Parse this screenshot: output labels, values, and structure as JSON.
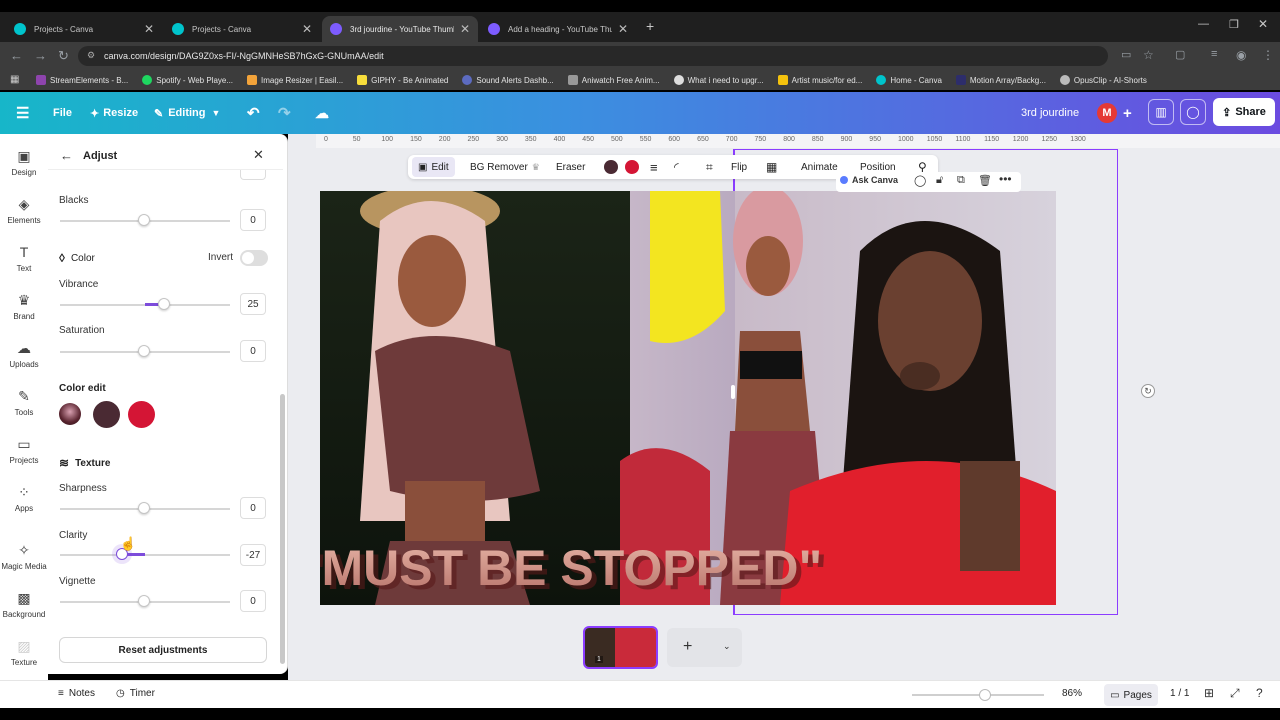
{
  "browser": {
    "tabs": [
      {
        "title": "Projects - Canva",
        "active": false
      },
      {
        "title": "Projects - Canva",
        "active": false
      },
      {
        "title": "3rd jourdine - YouTube Thumb",
        "active": true
      },
      {
        "title": "Add a heading - YouTube Thum",
        "active": false
      }
    ],
    "url": "canva.com/design/DAG9Z0xs-FI/-NgGMNHeSB7hGxG-GNUmAA/edit",
    "bookmarks": [
      "StreamElements - B...",
      "Spotify - Web Playe...",
      "Image Resizer | Easil...",
      "GIPHY - Be Animated",
      "Sound Alerts Dashb...",
      "Aniwatch Free Anim...",
      "What i need to upgr...",
      "Artist music/for ed...",
      "Home - Canva",
      "Motion Array/Backg...",
      "OpusClip - AI-Shorts"
    ]
  },
  "header": {
    "file": "File",
    "resize": "Resize",
    "editing": "Editing",
    "project_title": "3rd jourdine",
    "avatar_letter": "M",
    "share": "Share"
  },
  "rail": [
    "Design",
    "Elements",
    "Text",
    "Brand",
    "Uploads",
    "Tools",
    "Projects",
    "Apps",
    "Magic Media",
    "Background",
    "Texture"
  ],
  "panel": {
    "title": "Adjust",
    "blacks": {
      "label": "Blacks",
      "value": "0"
    },
    "color_section": "Color",
    "invert": "Invert",
    "vibrance": {
      "label": "Vibrance",
      "value": "25"
    },
    "saturation": {
      "label": "Saturation",
      "value": "0"
    },
    "color_edit": "Color edit",
    "texture_section": "Texture",
    "sharpness": {
      "label": "Sharpness",
      "value": "0"
    },
    "clarity": {
      "label": "Clarity",
      "value": "-27"
    },
    "vignette": {
      "label": "Vignette",
      "value": "0"
    },
    "reset": "Reset adjustments",
    "swatches": [
      "#4a2a33",
      "#d41535"
    ]
  },
  "toolbar": {
    "edit": "Edit",
    "bg_remover": "BG Remover",
    "eraser": "Eraser",
    "flip": "Flip",
    "animate": "Animate",
    "position": "Position",
    "ask_canva": "Ask Canva",
    "colors": [
      "#4a2a33",
      "#d41535"
    ]
  },
  "ruler_ticks": [
    "0",
    "50",
    "100",
    "150",
    "200",
    "250",
    "300",
    "350",
    "400",
    "450",
    "500",
    "550",
    "600",
    "650",
    "700",
    "750",
    "800",
    "850",
    "900",
    "950",
    "1000",
    "1050",
    "1100",
    "1150",
    "1200",
    "1250",
    "1300"
  ],
  "canvas": {
    "headline": "\"MUST BE STOPPED\""
  },
  "bottom": {
    "notes": "Notes",
    "timer": "Timer",
    "zoom": "86%",
    "pages": "Pages",
    "page_count": "1 / 1",
    "page_thumb_number": "1"
  }
}
